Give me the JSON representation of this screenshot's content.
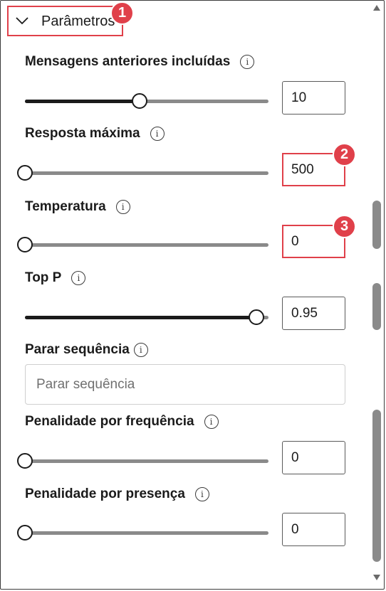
{
  "section": {
    "title": "Parâmetros",
    "icon": "chevron-down-icon"
  },
  "callouts": [
    "1",
    "2",
    "3"
  ],
  "params": {
    "past_messages": {
      "label": "Mensagens anteriores incluídas",
      "value": "10",
      "slider_fraction": 0.47
    },
    "max_response": {
      "label": "Resposta máxima",
      "value": "500",
      "slider_fraction": 0.0
    },
    "temperature": {
      "label": "Temperatura",
      "value": "0",
      "slider_fraction": 0.0
    },
    "top_p": {
      "label": "Top P",
      "value": "0.95",
      "slider_fraction": 0.95
    },
    "stop_sequence": {
      "label": "Parar sequência",
      "placeholder": "Parar sequência"
    },
    "frequency_penalty": {
      "label": "Penalidade por frequência",
      "value": "0",
      "slider_fraction": 0.0
    },
    "presence_penalty": {
      "label": "Penalidade por presença",
      "value": "0",
      "slider_fraction": 0.0
    }
  },
  "icons": {
    "info": "info-icon",
    "scroll_up": "scroll-up-arrow-icon",
    "scroll_down": "scroll-down-arrow-icon"
  },
  "colors": {
    "callout": "#e0404a",
    "slider_fill": "#1b1b1b",
    "slider_track": "#8a8a8a",
    "placeholder": "#707070"
  },
  "info_glyph": "i"
}
